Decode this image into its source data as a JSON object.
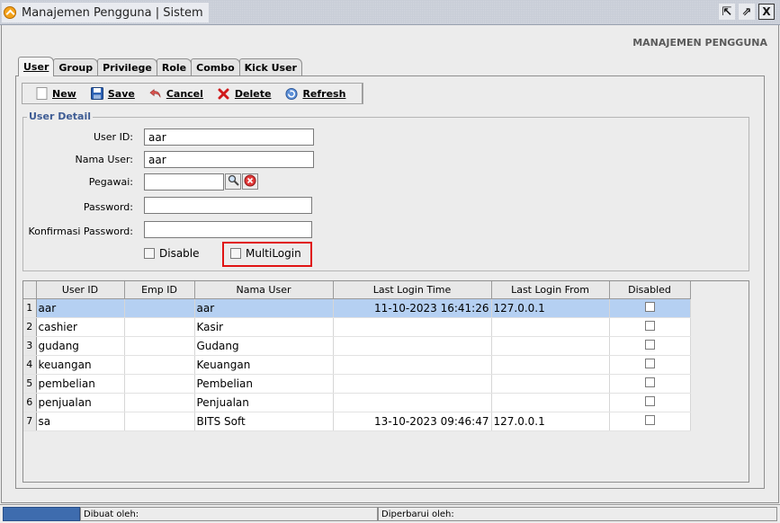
{
  "window": {
    "title": "Manajemen Pengguna | Sistem",
    "controls": {
      "restore": "⇱",
      "maximize": "⇗",
      "close": "X"
    }
  },
  "page_header": "MANAJEMEN PENGGUNA",
  "tabs": [
    {
      "label": "User",
      "active": true
    },
    {
      "label": "Group",
      "active": false
    },
    {
      "label": "Privilege",
      "active": false
    },
    {
      "label": "Role",
      "active": false
    },
    {
      "label": "Combo",
      "active": false
    },
    {
      "label": "Kick User",
      "active": false
    }
  ],
  "toolbar": {
    "new_label": "New",
    "save_label": "Save",
    "cancel_label": "Cancel",
    "delete_label": "Delete",
    "refresh_label": "Refresh"
  },
  "user_detail": {
    "legend": "User Detail",
    "user_id_label": "User ID:",
    "user_id_value": "aar",
    "nama_user_label": "Nama User:",
    "nama_user_value": "aar",
    "pegawai_label": "Pegawai:",
    "pegawai_value": "",
    "password_label": "Password:",
    "password_value": "",
    "konfirmasi_label": "Konfirmasi Password:",
    "konfirmasi_value": "",
    "disable_label": "Disable",
    "disable_checked": false,
    "multilogin_label": "MultiLogin",
    "multilogin_checked": false
  },
  "table": {
    "columns": [
      "User ID",
      "Emp ID",
      "Nama User",
      "Last Login Time",
      "Last Login From",
      "Disabled"
    ],
    "rows": [
      {
        "num": "1",
        "user_id": "aar",
        "emp_id": "",
        "nama": "aar",
        "login_time": "11-10-2023 16:41:26",
        "login_from": "127.0.0.1",
        "disabled": false,
        "selected": true
      },
      {
        "num": "2",
        "user_id": "cashier",
        "emp_id": "",
        "nama": "Kasir",
        "login_time": "",
        "login_from": "",
        "disabled": false,
        "selected": false
      },
      {
        "num": "3",
        "user_id": "gudang",
        "emp_id": "",
        "nama": "Gudang",
        "login_time": "",
        "login_from": "",
        "disabled": false,
        "selected": false
      },
      {
        "num": "4",
        "user_id": "keuangan",
        "emp_id": "",
        "nama": "Keuangan",
        "login_time": "",
        "login_from": "",
        "disabled": false,
        "selected": false
      },
      {
        "num": "5",
        "user_id": "pembelian",
        "emp_id": "",
        "nama": "Pembelian",
        "login_time": "",
        "login_from": "",
        "disabled": false,
        "selected": false
      },
      {
        "num": "6",
        "user_id": "penjualan",
        "emp_id": "",
        "nama": "Penjualan",
        "login_time": "",
        "login_from": "",
        "disabled": false,
        "selected": false
      },
      {
        "num": "7",
        "user_id": "sa",
        "emp_id": "",
        "nama": "BITS Soft",
        "login_time": "13-10-2023 09:46:47",
        "login_from": "127.0.0.1",
        "disabled": false,
        "selected": false
      }
    ]
  },
  "statusbar": {
    "dibuat_label": "Dibuat oleh:",
    "diperbarui_label": "Diperbarui oleh:"
  },
  "colors": {
    "legend": "#3e5c94",
    "selected_row": "#b5d0f2",
    "highlight_box": "#e01414",
    "status_accent": "#3e6cae"
  }
}
